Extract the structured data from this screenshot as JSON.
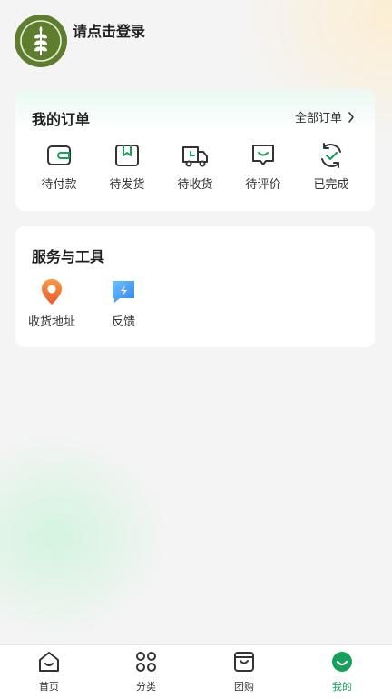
{
  "header": {
    "login_text": "请点击登录",
    "avatar_icon": "wheat-leaf-icon",
    "brand_color": "#5f7d2e"
  },
  "orders": {
    "title": "我的订单",
    "all_orders_label": "全部订单",
    "items": [
      {
        "label": "待付款",
        "icon": "wallet-icon"
      },
      {
        "label": "待发货",
        "icon": "package-box-icon"
      },
      {
        "label": "待收货",
        "icon": "delivery-truck-icon"
      },
      {
        "label": "待评价",
        "icon": "comment-icon"
      },
      {
        "label": "已完成",
        "icon": "completed-check-icon"
      }
    ],
    "accent_color": "#16a05a"
  },
  "services": {
    "title": "服务与工具",
    "items": [
      {
        "label": "收货地址",
        "icon": "location-pin-icon"
      },
      {
        "label": "反馈",
        "icon": "feedback-icon"
      }
    ]
  },
  "tabbar": {
    "items": [
      {
        "label": "首页",
        "icon": "home-icon"
      },
      {
        "label": "分类",
        "icon": "category-icon"
      },
      {
        "label": "团购",
        "icon": "shopping-bag-icon"
      },
      {
        "label": "我的",
        "icon": "profile-icon",
        "active": true
      }
    ],
    "active_color": "#16a05a"
  }
}
